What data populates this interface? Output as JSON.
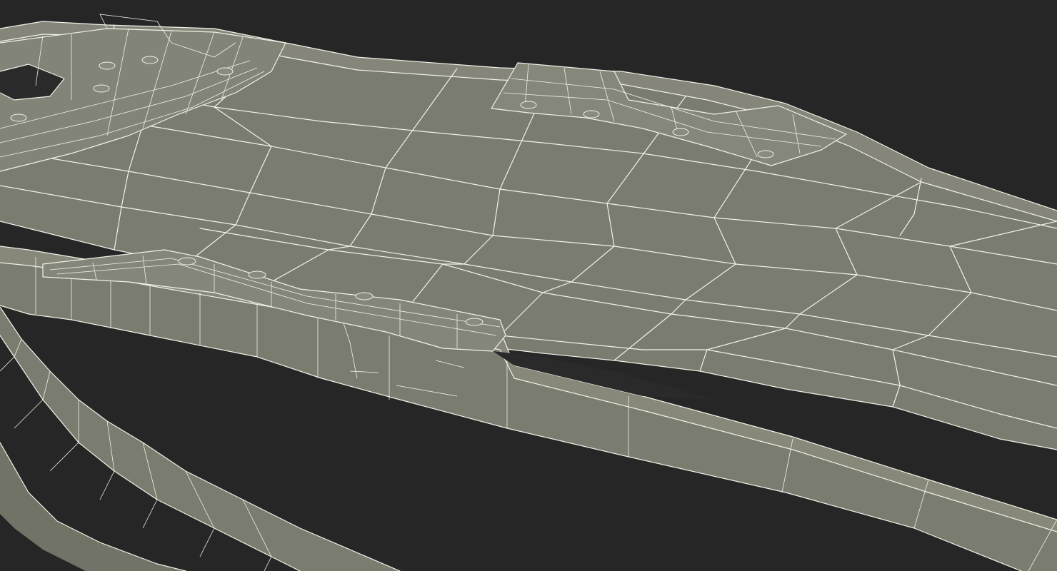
{
  "scene": {
    "subject": "3d-wireframe-mesh",
    "colors": {
      "background": "#262626",
      "surface": "#7b7c70",
      "surface_dark": "#6f7065",
      "surface_light": "#898a7e",
      "wire": "#f2f1e8"
    }
  }
}
